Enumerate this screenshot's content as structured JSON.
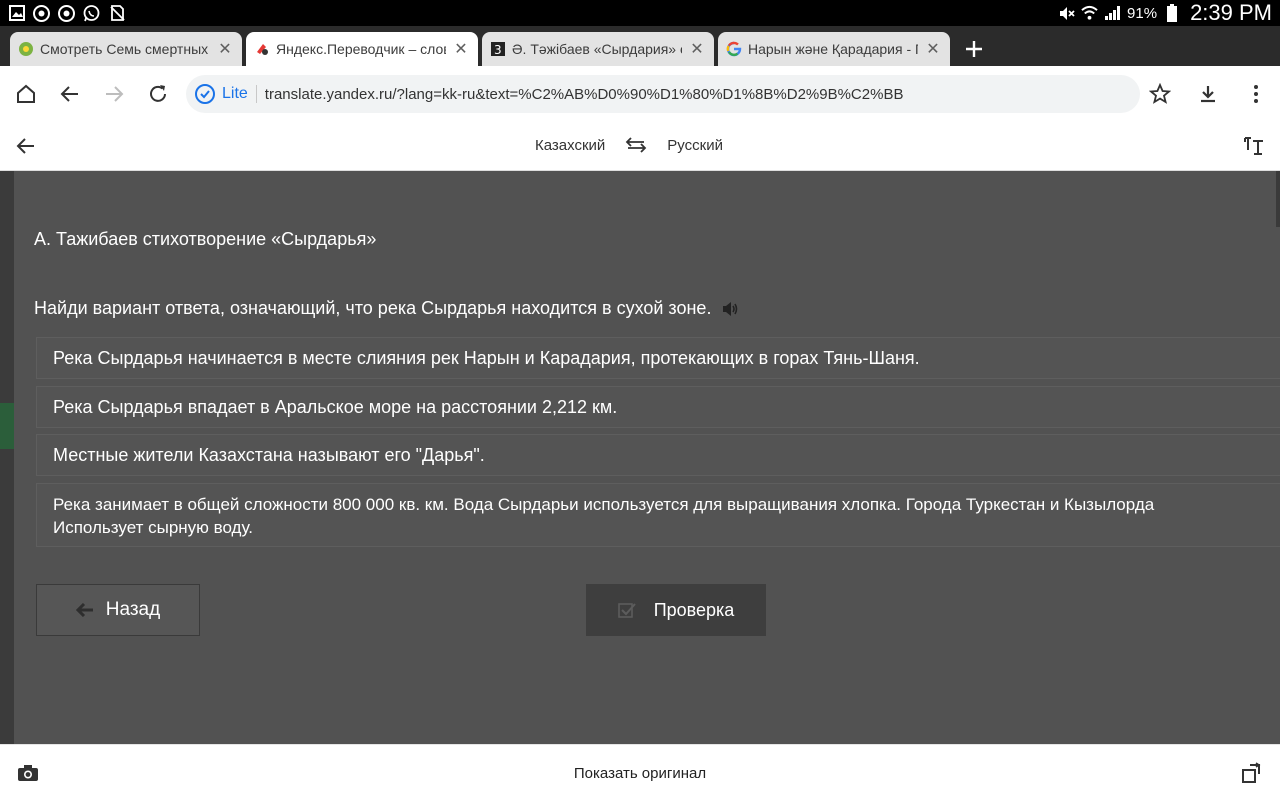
{
  "status_bar": {
    "battery_percent": "91%",
    "time": "2:39 PM",
    "left_icons": [
      "gallery-icon",
      "chrome-icon",
      "chrome-icon",
      "whatsapp-icon",
      "no-sim-icon"
    ],
    "right_icons": [
      "mute-icon",
      "wifi-icon",
      "signal-icon",
      "battery-icon"
    ]
  },
  "tabs": [
    {
      "title": "Смотреть Семь смертных г",
      "favicon": "film-icon",
      "active": false
    },
    {
      "title": "Яндекс.Переводчик – слов",
      "favicon": "yandex-translate-icon",
      "active": true
    },
    {
      "title": "Ә. Тәжібаев «Сырдария» өл",
      "favicon": "site-icon",
      "active": false
    },
    {
      "title": "Нарын және Қарадария - П",
      "favicon": "google-icon",
      "active": false
    }
  ],
  "omnibox": {
    "lite_label": "Lite",
    "url": "translate.yandex.ru/?lang=kk-ru&text=%C2%AB%D0%90%D1%80%D1%8B%D2%9B%C2%BB"
  },
  "translator": {
    "source_lang": "Казахский",
    "target_lang": "Русский"
  },
  "content": {
    "poem_title": "А. Тажибаев стихотворение «Сырдарья»",
    "question": "Найди вариант ответа, означающий, что река Сырдарья находится в сухой зоне.",
    "options": [
      "Река Сырдарья начинается в месте слияния рек Нарын и Карадария, протекающих в горах Тянь-Шаня.",
      "Река Сырдарья впадает в Аральское море на расстоянии 2,212 км.",
      "Местные жители Казахстана называют его \"Дарья\".",
      "Река занимает в общей сложности 800 000 кв. км. Вода Сырдарьи используется для выращивания хлопка. Города Туркестан и Кызылорда Использует сырную воду."
    ],
    "back_button": "Назад",
    "check_button": "Проверка"
  },
  "bottom_bar": {
    "show_original": "Показать оригинал"
  }
}
